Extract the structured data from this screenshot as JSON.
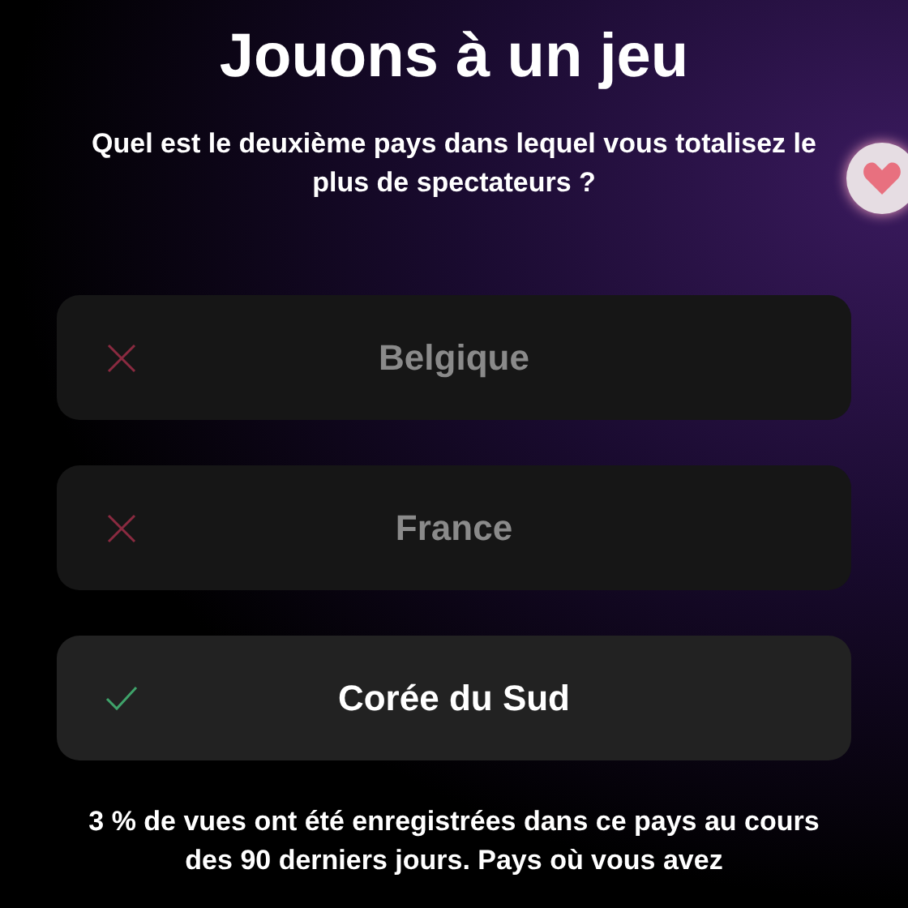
{
  "title": "Jouons à un jeu",
  "question": "Quel est le deuxième pays dans lequel vous totalisez le plus de spectateurs ?",
  "options": [
    {
      "label": "Belgique",
      "kind": "wrong"
    },
    {
      "label": "France",
      "kind": "wrong"
    },
    {
      "label": "Corée du Sud",
      "kind": "correct"
    }
  ],
  "explanation": "3 % de vues ont été enregistrées dans ce pays au cours des 90 derniers jours. Pays où vous avez"
}
